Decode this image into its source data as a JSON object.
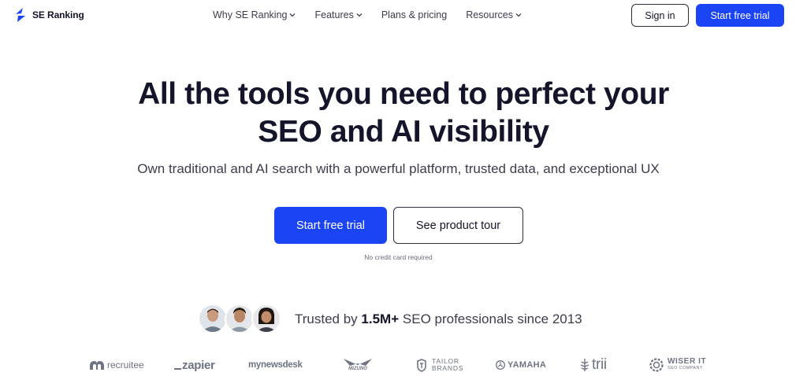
{
  "header": {
    "logo_text": "SE Ranking",
    "nav": [
      {
        "label": "Why SE Ranking",
        "has_dropdown": true
      },
      {
        "label": "Features",
        "has_dropdown": true
      },
      {
        "label": "Plans & pricing",
        "has_dropdown": false
      },
      {
        "label": "Resources",
        "has_dropdown": true
      }
    ],
    "signin_label": "Sign in",
    "trial_label": "Start free trial"
  },
  "hero": {
    "title_line1": "All the tools you need to perfect your",
    "title_line2": "SEO and AI visibility",
    "subtitle": "Own traditional and AI search with a powerful platform, trusted data, and exceptional UX",
    "primary_cta": "Start free trial",
    "secondary_cta": "See product tour",
    "note": "No credit card required"
  },
  "trust": {
    "prefix": "Trusted by",
    "count": "1.5M+",
    "suffix": "SEO professionals since 2013"
  },
  "brands": {
    "recruitee": "recruitee",
    "zapier": "zapier",
    "newsdesk": "mynewsdesk",
    "mizuno": "MIZUNO",
    "tailor_top": "TAILOR",
    "tailor_bottom": "BRANDS",
    "yamaha": "YAMAHA",
    "trii": "trii",
    "wiser_top": "WISER IT",
    "wiser_bottom": "SEO COMPANY"
  },
  "colors": {
    "accent": "#1b44f5",
    "text": "#14142b",
    "muted": "#6f7384"
  }
}
